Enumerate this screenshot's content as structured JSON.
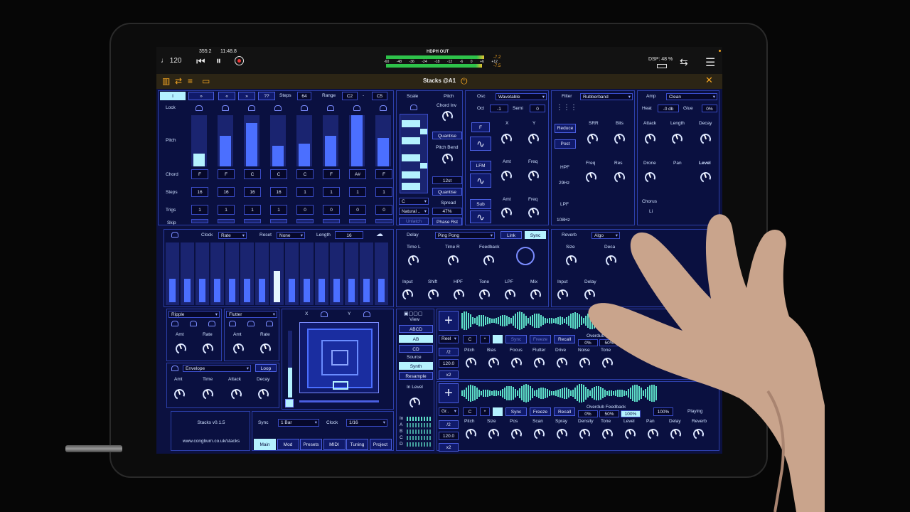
{
  "host": {
    "tempo": "♩ 120",
    "position": "355:2",
    "time": "11:48.8",
    "output": "HDPH OUT",
    "meter_scale": [
      "-60",
      "-48",
      "-36",
      "-24",
      "-18",
      "-12",
      "-6",
      "0",
      "+6",
      "+12"
    ],
    "peak_top": "-7.2",
    "peak_bottom": "-7.5",
    "dsp": "DSP: 48 %"
  },
  "plugin": {
    "title": "Stacks @A1"
  },
  "seq": {
    "tabs": [
      "I",
      "»",
      "«",
      "»",
      "??"
    ],
    "steps_label": "Steps",
    "steps_value": "64",
    "range_label": "Range",
    "range_low": "C2",
    "range_sep": "-",
    "range_high": "C5",
    "row_lock": "Lock",
    "row_pitch": "Pitch",
    "row_chord": "Chord",
    "row_steps": "Steps",
    "row_trigs": "Trigs",
    "row_skip": "Skip",
    "pitch_levels": [
      0.25,
      0.6,
      0.85,
      0.4,
      0.45,
      0.6,
      1.0,
      0.55
    ],
    "chords": [
      "F",
      "F",
      "C",
      "C",
      "C",
      "F",
      "A#",
      "F"
    ],
    "steps": [
      "16",
      "16",
      "16",
      "16",
      "1",
      "1",
      "1",
      "1"
    ],
    "trigs": [
      "1",
      "1",
      "1",
      "1",
      "0",
      "0",
      "0",
      "0"
    ]
  },
  "scale": {
    "label": "Scale",
    "key": "C",
    "mode": "Natural ..",
    "unlatch": "Unlatch"
  },
  "pitch": {
    "label": "Pitch",
    "chord_inv": "Chord Inv",
    "quantise1": "Quantise",
    "pitch_bend": "Pitch Bend",
    "range": "12st",
    "quantise2": "Quantise",
    "spread": "Spread",
    "spread_value": "47%",
    "phase_rst": "Phase Rst"
  },
  "osc": {
    "label": "Osc",
    "type": "Wavetable",
    "oct_label": "Oct",
    "oct_value": "-1",
    "semi_label": "Semi",
    "semi_value": "0",
    "f_btn": "F",
    "x": "X",
    "y": "Y",
    "lfm": "LFM",
    "amt": "Amt",
    "freq": "Freq",
    "sub": "Sub",
    "amt2": "Amt",
    "freq2": "Freq"
  },
  "filter": {
    "label": "Filter",
    "type": "Rubberband",
    "reduce": "Reduce",
    "post": "Post",
    "srr": "SRR",
    "bits": "Bits",
    "hpf": "HPF",
    "hpf_value": "29Hz",
    "freq": "Freq",
    "res": "Res",
    "lpf": "LPF",
    "lpf_value": "108Hz"
  },
  "amp": {
    "label": "Amp",
    "type": "Clean",
    "heat": "Heat",
    "heat_value": "-0 db",
    "glue": "Glue",
    "glue_value": "0%",
    "attack": "Attack",
    "length": "Length",
    "decay": "Decay",
    "drone": "Drone",
    "pan": "Pan",
    "level": "Level",
    "chorus": "Chorus",
    "li": "Li"
  },
  "mod": {
    "clock": "Clock",
    "clock_mode": "Rate",
    "reset": "Reset",
    "reset_mode": "None",
    "length": "Length",
    "length_value": "16",
    "bars": [
      0.75,
      0.75,
      0.75,
      0.75,
      0.75,
      0.75,
      0.75,
      1.0,
      0.75,
      0.75,
      0.75,
      0.75,
      0.75,
      0.75,
      0.75
    ]
  },
  "delay": {
    "label": "Delay",
    "mode": "Ping Pong",
    "link": "Link",
    "sync": "Sync",
    "time_l": "Time L",
    "time_r": "Time R",
    "feedback": "Feedback",
    "input": "Input",
    "shift": "Shift",
    "hpf": "HPF",
    "tone": "Tone",
    "lpf": "LPF",
    "mix": "Mix"
  },
  "reverb": {
    "label": "Reverb",
    "algo": "Algo",
    "size": "Size",
    "decay": "Deca",
    "input": "Input",
    "delay": "Delay"
  },
  "lfo1": {
    "type": "Ripple",
    "amt": "Amt",
    "rate": "Rate"
  },
  "lfo2": {
    "type": "Flutter",
    "amt": "Amt",
    "rate": "Rate"
  },
  "env": {
    "type": "Envelope",
    "loop": "Loop",
    "amt": "Amt",
    "time": "Time",
    "attack": "Attack",
    "decay": "Decay"
  },
  "xy": {
    "x": "X",
    "y": "Y",
    "level": 0.45
  },
  "info": {
    "version": "Stacks v0.1.5",
    "url": "www.congburn.co.uk/stacks"
  },
  "footer": {
    "sync": "Sync",
    "sync_value": "1 Bar",
    "clock": "Clock",
    "clock_value": "1/16",
    "tabs": [
      "Main",
      "Mod",
      "Presets",
      "MIDI",
      "Tuning",
      "Project"
    ]
  },
  "view": {
    "view": "View",
    "abcd": "ABCD",
    "ab": "AB",
    "cd": "CD",
    "source": "Source",
    "synth": "Synth",
    "resample": "Resample",
    "in_level": "In Level",
    "channels": [
      "In",
      "A",
      "B",
      "C",
      "D"
    ]
  },
  "looper1": {
    "mode": "Reel",
    "c": "C",
    "star": "*",
    "sync": "Sync",
    "freeze": "Freeze",
    "recall": "Recall",
    "overdub": "Overdub Fe",
    "od0": "0%",
    "od1": "50%",
    "div": "/2",
    "tempo": "120.0",
    "mult": "x2",
    "knobs": [
      "Pitch",
      "Bias",
      "Focus",
      "Flutter",
      "Drive",
      "Noise",
      "Tone"
    ]
  },
  "looper2": {
    "mode": "Gr..",
    "c": "C",
    "star": "*",
    "sync": "Sync",
    "freeze": "Freeze",
    "recall": "Recall",
    "overdub": "Overdub Feedback",
    "od0": "0%",
    "od1": "50%",
    "od2": "100%",
    "od3": "100%",
    "playing": "Playing",
    "div": "/2",
    "tempo": "120.0",
    "mult": "x2",
    "knobs": [
      "Pitch",
      "Size",
      "Pos",
      "Scan",
      "Spray",
      "Density",
      "Tone",
      "Level",
      "Pan",
      "Delay",
      "Reverb"
    ]
  }
}
